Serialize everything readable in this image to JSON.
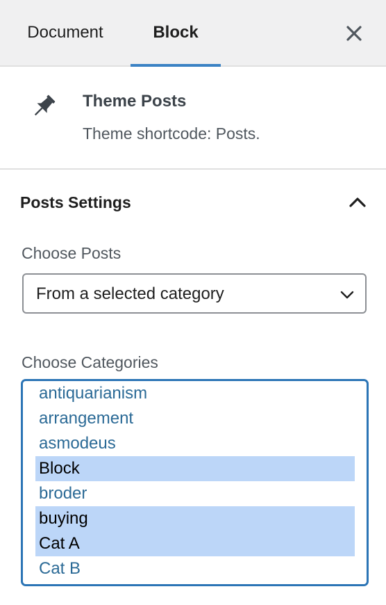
{
  "tabs": {
    "document_label": "Document",
    "block_label": "Block",
    "active": "Block"
  },
  "close_icon": "close-icon",
  "block": {
    "icon": "pin-icon",
    "title": "Theme Posts",
    "description": "Theme shortcode: Posts."
  },
  "panel": {
    "title": "Posts Settings",
    "expanded": true,
    "choose_posts_label": "Choose Posts",
    "choose_posts_value": "From a selected category",
    "choose_categories_label": "Choose Categories",
    "categories": [
      {
        "label": "antiquarianism",
        "selected": false
      },
      {
        "label": "arrangement",
        "selected": false
      },
      {
        "label": "asmodeus",
        "selected": false
      },
      {
        "label": "Block",
        "selected": true
      },
      {
        "label": "broder",
        "selected": false
      },
      {
        "label": "buying",
        "selected": true
      },
      {
        "label": "Cat A",
        "selected": true
      },
      {
        "label": "Cat B",
        "selected": false
      }
    ]
  },
  "colors": {
    "accent": "#3b82c4",
    "link": "#2b6a96",
    "selected_bg": "#bcd6f8",
    "tabbar_bg": "#f0f0f1"
  }
}
